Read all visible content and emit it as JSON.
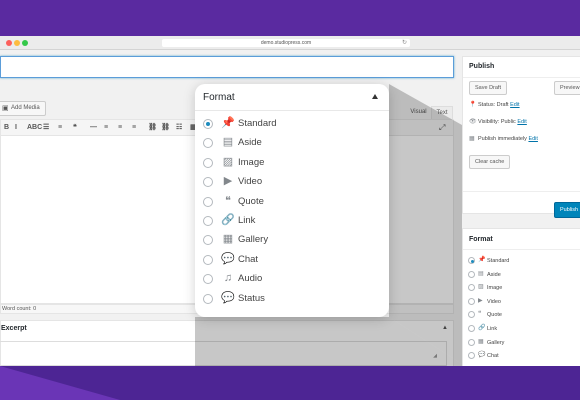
{
  "browser": {
    "url": "demo.studiopress.com"
  },
  "editor": {
    "add_media_label": "Add Media",
    "tabs": {
      "visual": "Visual",
      "text": "Text"
    },
    "toolbar_buttons": [
      "B",
      "I",
      "ABC",
      "☰",
      "≡",
      "❝",
      "—",
      "≡",
      "≡",
      "≡",
      "⛓",
      "⛓",
      "☷",
      "▦"
    ],
    "word_count": "Word count: 0"
  },
  "excerpt": {
    "title": "Excerpt"
  },
  "publish": {
    "title": "Publish",
    "save_draft": "Save Draft",
    "preview": "Preview",
    "status_label": "Status: Draft",
    "visibility_label": "Visibility: Public",
    "schedule_label": "Publish immediately",
    "edit": "Edit",
    "clear_cache": "Clear cache",
    "publish_button": "Publish"
  },
  "format": {
    "title": "Format",
    "selected": "Standard",
    "options": [
      {
        "label": "Standard",
        "icon": "pin-icon"
      },
      {
        "label": "Aside",
        "icon": "aside-icon"
      },
      {
        "label": "Image",
        "icon": "image-icon"
      },
      {
        "label": "Video",
        "icon": "video-icon"
      },
      {
        "label": "Quote",
        "icon": "quote-icon"
      },
      {
        "label": "Link",
        "icon": "link-icon"
      },
      {
        "label": "Gallery",
        "icon": "gallery-icon"
      },
      {
        "label": "Chat",
        "icon": "chat-icon"
      },
      {
        "label": "Audio",
        "icon": "audio-icon"
      },
      {
        "label": "Status",
        "icon": "status-icon"
      }
    ]
  },
  "colors": {
    "background": "#5a2d9c",
    "accent": "#0085ba",
    "radio_selected": "#1e8cbe"
  }
}
